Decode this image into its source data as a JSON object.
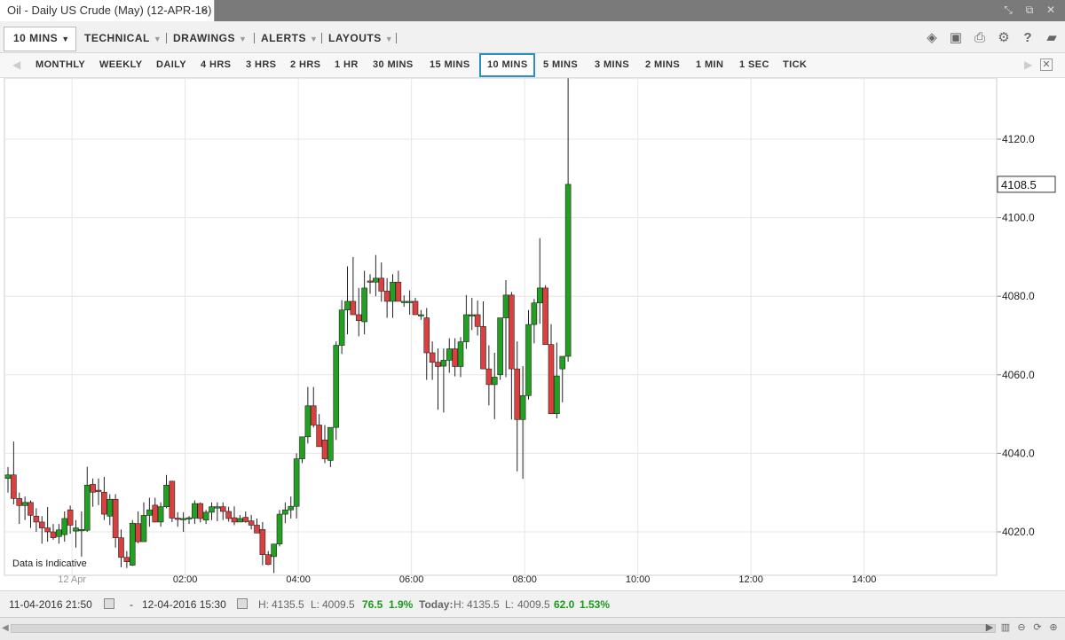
{
  "window": {
    "title": "Oil - Daily US Crude (May) (12-APR-16)",
    "close_glyph": "×",
    "controls": [
      "restore-icon",
      "popout-icon",
      "close-icon"
    ]
  },
  "toolbar": {
    "interval": "10 MINS",
    "technical": "TECHNICAL",
    "drawings": "DRAWINGS",
    "alerts": "ALERTS",
    "layouts": "LAYOUTS",
    "icons": [
      "layers-icon",
      "image-icon",
      "print-icon",
      "gear-icon",
      "help-icon",
      "comment-icon"
    ]
  },
  "periods": {
    "items": [
      "MONTHLY",
      "WEEKLY",
      "DAILY",
      "4 HRS",
      "3 HRS",
      "2 HRS",
      "1 HR",
      "30 MINS",
      "15 MINS",
      "10 MINS",
      "5 MINS",
      "3 MINS",
      "2 MINS",
      "1 MIN",
      "1 SEC",
      "TICK"
    ],
    "active": "10 MINS"
  },
  "chart_data": {
    "type": "candlestick",
    "note": "Data is Indicative",
    "last_price": "4108.5",
    "ylim": [
      4008,
      4135.5
    ],
    "yticks": [
      4020.0,
      4040.0,
      4060.0,
      4080.0,
      4100.0,
      4120.0
    ],
    "ytick_labels": [
      "4020.0",
      "4040.0",
      "4060.0",
      "4080.0",
      "4100.0",
      "4120.0"
    ],
    "xtick_labels": [
      "12 Apr",
      "02:00",
      "04:00",
      "06:00",
      "08:00",
      "10:00",
      "12:00",
      "14:00"
    ],
    "xtick_index": [
      11,
      31,
      51,
      71,
      91,
      111,
      131,
      151
    ],
    "grid": true,
    "up_color": "#22a022",
    "down_color": "#d94040",
    "candles": [
      [
        4033.6,
        4036.5,
        4030,
        4034.5
      ],
      [
        4034.5,
        4043,
        4027,
        4028.5
      ],
      [
        4028.5,
        4030,
        4022,
        4026.7
      ],
      [
        4026.7,
        4029,
        4023,
        4027.5
      ],
      [
        4027.5,
        4028,
        4021,
        4024.2
      ],
      [
        4024,
        4026,
        4020,
        4022.5
      ],
      [
        4022.5,
        4024,
        4017,
        4021
      ],
      [
        4021,
        4026.3,
        4017.5,
        4020
      ],
      [
        4020,
        4022,
        4018,
        4018.5
      ],
      [
        4018.8,
        4022,
        4017,
        4020.5
      ],
      [
        4019.3,
        4025.2,
        4017.5,
        4023.4
      ],
      [
        4025.6,
        4026.7,
        4019.5,
        4021.7
      ],
      [
        4020.2,
        4023,
        4016,
        4021
      ],
      [
        4020.6,
        4025.2,
        4013.7,
        4020.6
      ],
      [
        4020.4,
        4036.6,
        4020,
        4031.9
      ],
      [
        4032.1,
        4033.6,
        4026.4,
        4030.1
      ],
      [
        4030.6,
        4033.6,
        4026.8,
        4030.3
      ],
      [
        4030.1,
        4034,
        4023,
        4024.5
      ],
      [
        4024,
        4029.6,
        4021.7,
        4028.3
      ],
      [
        4028.3,
        4029.6,
        4016,
        4018.5
      ],
      [
        4018.5,
        4020.6,
        4011,
        4013.5
      ],
      [
        4013.5,
        4015.1,
        4010.8,
        4012.4
      ],
      [
        4011.5,
        4023,
        4011.3,
        4022.2
      ],
      [
        4022.1,
        4025.2,
        4017.1,
        4017.5
      ],
      [
        4017.5,
        4027.5,
        4017.5,
        4024.2
      ],
      [
        4024.2,
        4028.7,
        4021.3,
        4025.6
      ],
      [
        4026.8,
        4028.7,
        4022.4,
        4022.5
      ],
      [
        4022.5,
        4027.5,
        4021.3,
        4026.4
      ],
      [
        4026.4,
        4034.5,
        4026,
        4031.9
      ],
      [
        4032.9,
        4033,
        4022.5,
        4023.5
      ],
      [
        4023.5,
        4025,
        4021.3,
        4023.4
      ],
      [
        4023.4,
        4025,
        4020,
        4023.4
      ],
      [
        4023.4,
        4024,
        4022,
        4023.6
      ],
      [
        4023.5,
        4028,
        4022,
        4027.2
      ],
      [
        4027.2,
        4027.5,
        4022.4,
        4023.4
      ],
      [
        4023,
        4025.6,
        4022,
        4025
      ],
      [
        4025,
        4027.5,
        4023,
        4026.4
      ],
      [
        4026.3,
        4027.5,
        4022.7,
        4026.4
      ],
      [
        4026.4,
        4027.5,
        4023,
        4025.2
      ],
      [
        4025.2,
        4026.4,
        4022.6,
        4023.4
      ],
      [
        4023.6,
        4026.5,
        4021.7,
        4022.5
      ],
      [
        4022.5,
        4024.3,
        4022.5,
        4023.4
      ],
      [
        4023.7,
        4025.2,
        4022.3,
        4022.6
      ],
      [
        4022.8,
        4024.3,
        4020.6,
        4021.7
      ],
      [
        4021.7,
        4023.4,
        4020.2,
        4019.7
      ],
      [
        4020.6,
        4022.5,
        4011.5,
        4014.2
      ],
      [
        4014.2,
        4015.1,
        4011.5,
        4011.7
      ],
      [
        4013.7,
        4016,
        4009.5,
        4016.9
      ],
      [
        4016.9,
        4025.6,
        4016.3,
        4024.5
      ],
      [
        4024.5,
        4027.5,
        4022.2,
        4025.6
      ],
      [
        4025.6,
        4029,
        4023.4,
        4026.5
      ],
      [
        4026.5,
        4040,
        4023.4,
        4038.6
      ],
      [
        4038.6,
        4044.2,
        4037.5,
        4044.2
      ],
      [
        4044.2,
        4056.9,
        4042.5,
        4052.1
      ],
      [
        4052.1,
        4056.9,
        4046.6,
        4047.2
      ],
      [
        4047.2,
        4050,
        4043.4,
        4041.7
      ],
      [
        4043.4,
        4047.2,
        4037.5,
        4038.6
      ],
      [
        4038.2,
        4046.6,
        4036.5,
        4046.6
      ],
      [
        4046.6,
        4068.5,
        4043.4,
        4067.5
      ],
      [
        4067.5,
        4079,
        4065.3,
        4076.5
      ],
      [
        4076.5,
        4087.6,
        4070.3,
        4078.7
      ],
      [
        4078.7,
        4090,
        4075.3,
        4075.3
      ],
      [
        4075.3,
        4082.1,
        4069.8,
        4073.8
      ],
      [
        4073.5,
        4086.5,
        4070.3,
        4082.1
      ],
      [
        4083.9,
        4085.6,
        4080.6,
        4083.6
      ],
      [
        4083.6,
        4090.5,
        4080,
        4084.6
      ],
      [
        4084.6,
        4088.6,
        4078.6,
        4081.3
      ],
      [
        4081.3,
        4084.6,
        4074.5,
        4078.7
      ],
      [
        4078.7,
        4085.6,
        4074.5,
        4083.6
      ],
      [
        4083.6,
        4086.5,
        4078.7,
        4078.7
      ],
      [
        4078.7,
        4080.2,
        4077.3,
        4078.7
      ],
      [
        4078.7,
        4081.5,
        4075.3,
        4078.7
      ],
      [
        4078.7,
        4079.6,
        4075.3,
        4075.3
      ],
      [
        4075.3,
        4076.5,
        4074,
        4075.3
      ],
      [
        4074.5,
        4077,
        4058.7,
        4065.6
      ],
      [
        4065.6,
        4068.5,
        4058.7,
        4063.2
      ],
      [
        4063.2,
        4066.7,
        4051.1,
        4062.1
      ],
      [
        4062.2,
        4066.7,
        4050.4,
        4063.7
      ],
      [
        4063.7,
        4069.3,
        4060.5,
        4066.6
      ],
      [
        4066.6,
        4069.3,
        4059.6,
        4062.1
      ],
      [
        4062.1,
        4069.6,
        4059.4,
        4068.4
      ],
      [
        4068.4,
        4080.3,
        4066.6,
        4075.3
      ],
      [
        4075.3,
        4079.6,
        4071.4,
        4075.3
      ],
      [
        4075.3,
        4078.9,
        4070,
        4072.3
      ],
      [
        4072.3,
        4078.7,
        4061.5,
        4061.5
      ],
      [
        4061.5,
        4067.5,
        4052.2,
        4057.5
      ],
      [
        4057.5,
        4065.6,
        4048.7,
        4059.4
      ],
      [
        4060,
        4072.3,
        4058.7,
        4074.5
      ],
      [
        4074.5,
        4084.1,
        4059.4,
        4080.3
      ],
      [
        4080.3,
        4081.1,
        4048.6,
        4061.5
      ],
      [
        4061.5,
        4068.5,
        4035.4,
        4048.6
      ],
      [
        4048.6,
        4062.2,
        4033.5,
        4054.7
      ],
      [
        4054.7,
        4076.5,
        4053.7,
        4072.8
      ],
      [
        4072.8,
        4079.3,
        4068,
        4078.3
      ],
      [
        4078.3,
        4094.8,
        4073,
        4082.1
      ],
      [
        4082.1,
        4082.8,
        4069.4,
        4067.7
      ],
      [
        4067.7,
        4072.9,
        4050.8,
        4050.1
      ],
      [
        4050.1,
        4068.2,
        4048.9,
        4059.7
      ],
      [
        4061.5,
        4064.6,
        4053,
        4064.7
      ],
      [
        4064.7,
        4135.5,
        4063.3,
        4108.5
      ]
    ]
  },
  "footer": {
    "from": "11-04-2016 21:50",
    "dash": "-",
    "to": "12-04-2016 15:30",
    "high_label": "H:",
    "high": "4135.5",
    "low_label": "L:",
    "low": "4009.5",
    "change": "76.5",
    "change_pct": "1.9%",
    "today_label": "Today:",
    "today_high": "4135.5",
    "today_low": "4009.5",
    "today_change": "62.0",
    "today_change_pct": "1.53%"
  }
}
